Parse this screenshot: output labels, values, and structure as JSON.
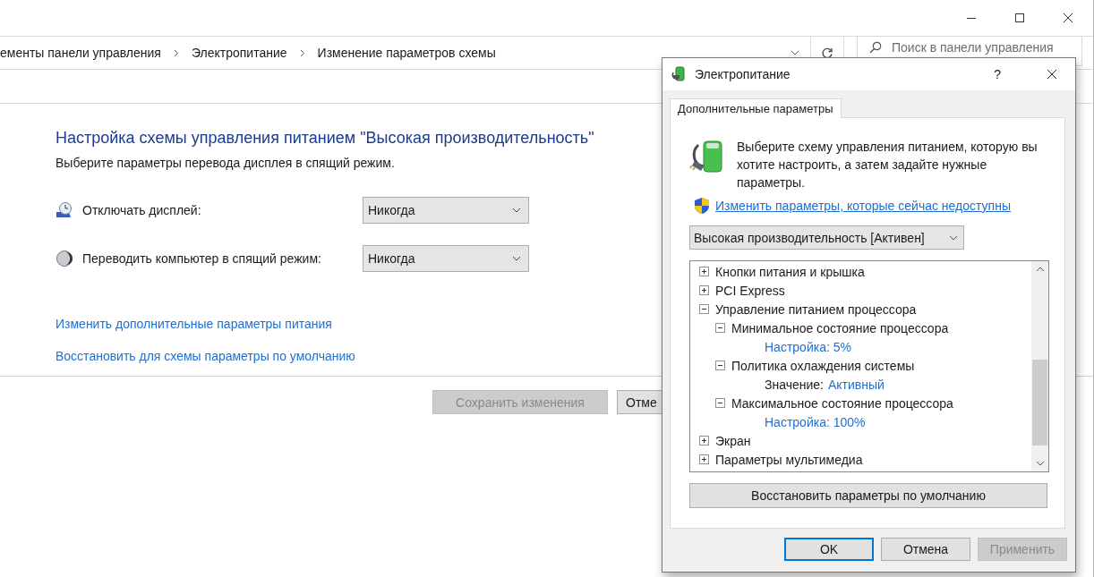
{
  "main_window": {
    "breadcrumbs": [
      "ементы панели управления",
      "Электропитание",
      "Изменение параметров схемы"
    ],
    "search": {
      "placeholder": "Поиск в панели управления"
    },
    "heading": "Настройка схемы управления питанием \"Высокая производительность\"",
    "subtitle": "Выберите параметры перевода дисплея в спящий режим.",
    "settings": [
      {
        "kind": "display",
        "label": "Отключать дисплей:",
        "value": "Никогда"
      },
      {
        "kind": "sleep",
        "label": "Переводить компьютер в спящий режим:",
        "value": "Никогда"
      }
    ],
    "links": [
      "Изменить дополнительные параметры питания",
      "Восстановить для схемы параметры по умолчанию"
    ],
    "buttons": [
      {
        "label": "Сохранить изменения",
        "disabled": true
      },
      {
        "label": "Отме",
        "disabled": false
      }
    ]
  },
  "dialog": {
    "title": "Электропитание",
    "help": "?",
    "tabs": [
      {
        "label": "Дополнительные параметры",
        "selected": true
      }
    ],
    "description": "Выберите схему управления питанием, которую вы хотите настроить, а затем задайте нужные параметры.",
    "admin_link": "Изменить параметры, которые сейчас недоступны",
    "scheme": "Высокая производительность [Активен]",
    "tree": [
      {
        "label": "Кнопки питания и крышка",
        "expanded": false
      },
      {
        "label": "PCI Express",
        "expanded": false
      },
      {
        "label": "Управление питанием процессора",
        "expanded": true,
        "children": [
          {
            "label": "Минимальное состояние процессора",
            "expanded": true,
            "children": [
              {
                "kind": "setting",
                "label": "Настройка:",
                "value": "5%"
              }
            ]
          },
          {
            "label": "Политика охлаждения системы",
            "expanded": true,
            "children": [
              {
                "kind": "value",
                "label": "Значение:",
                "value": "Активный"
              }
            ]
          },
          {
            "label": "Максимальное состояние процессора",
            "expanded": true,
            "children": [
              {
                "kind": "setting",
                "label": "Настройка:",
                "value": "100%"
              }
            ]
          }
        ]
      },
      {
        "label": "Экран",
        "expanded": false
      },
      {
        "label": "Параметры мультимедиа",
        "expanded": false
      }
    ],
    "restore_button": "Восстановить параметры по умолчанию",
    "buttons": [
      {
        "label": "OK",
        "default": true,
        "disabled": false
      },
      {
        "label": "Отмена",
        "default": false,
        "disabled": false
      },
      {
        "label": "Применить",
        "default": false,
        "disabled": true
      }
    ]
  }
}
